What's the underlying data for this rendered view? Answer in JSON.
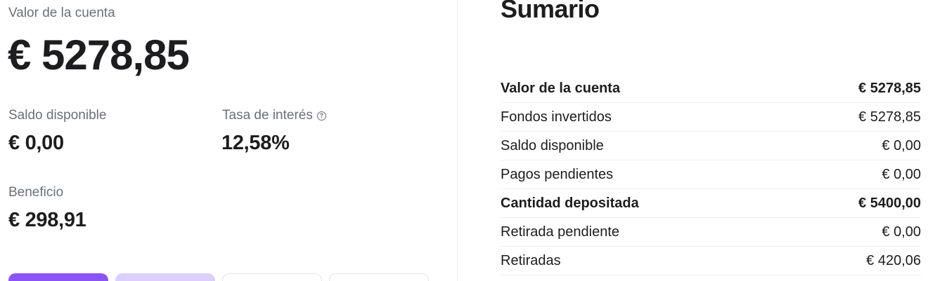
{
  "account": {
    "label": "Valor de la cuenta",
    "value": "€ 5278,85"
  },
  "stats": {
    "balance_label": "Saldo disponible",
    "balance_value": "€ 0,00",
    "rate_label": "Tasa de interés",
    "rate_info_icon": "?",
    "rate_value": "12,58%",
    "profit_label": "Beneficio",
    "profit_value": "€ 298,91"
  },
  "colors": {
    "primary_button": "#8b55f5",
    "secondary_button": "#dcd0fb"
  },
  "summary": {
    "title": "Sumario",
    "rows": [
      {
        "label": "Valor de la cuenta",
        "value": "€ 5278,85",
        "bold": true
      },
      {
        "label": "Fondos invertidos",
        "value": "€ 5278,85",
        "bold": false
      },
      {
        "label": "Saldo disponible",
        "value": "€ 0,00",
        "bold": false
      },
      {
        "label": "Pagos pendientes",
        "value": "€ 0,00",
        "bold": false
      },
      {
        "label": "Cantidad depositada",
        "value": "€ 5400,00",
        "bold": true
      },
      {
        "label": "Retirada pendiente",
        "value": "€ 0,00",
        "bold": false
      },
      {
        "label": "Retiradas",
        "value": "€ 420,06",
        "bold": false
      }
    ]
  }
}
